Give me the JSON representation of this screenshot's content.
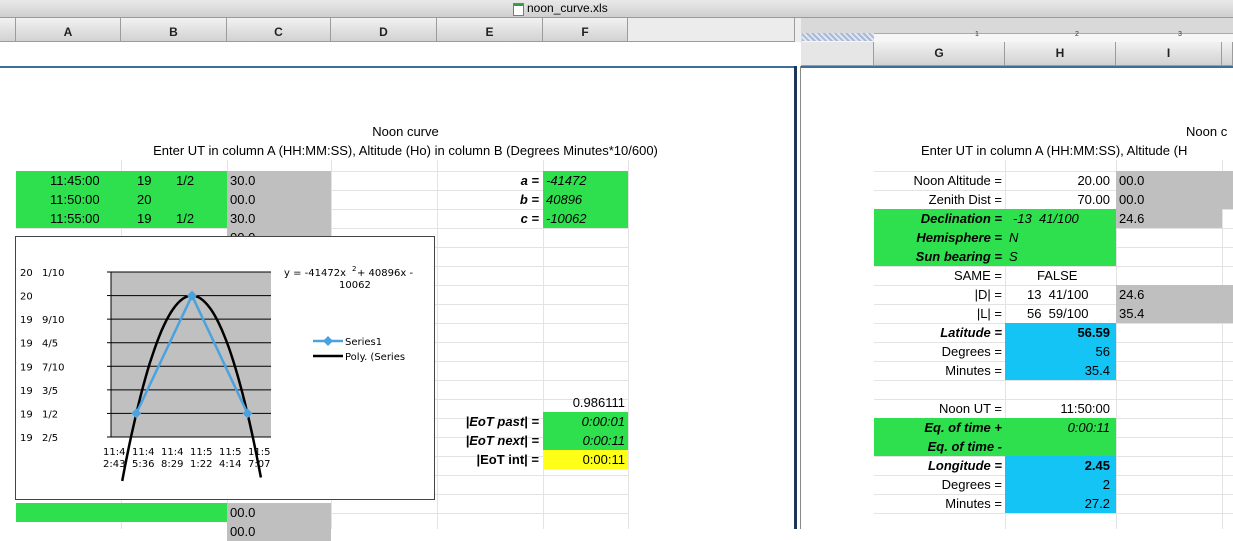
{
  "window": {
    "title": "noon_curve.xls"
  },
  "columns": [
    "A",
    "B",
    "C",
    "D",
    "E",
    "F",
    "G",
    "H",
    "I"
  ],
  "ruler_marks": [
    "1",
    "2",
    "3"
  ],
  "left": {
    "title": "Noon curve",
    "subtitle": "Enter UT in column A (HH:MM:SS), Altitude (Ho) in column B (Degrees Minutes*10/600)",
    "rows": [
      {
        "a": "11:45:00",
        "b": "19",
        "frac": "1/2",
        "c": "30.0"
      },
      {
        "a": "11:50:00",
        "b": "20",
        "frac": "",
        "c": "00.0"
      },
      {
        "a": "11:55:00",
        "b": "19",
        "frac": "1/2",
        "c": "30.0"
      }
    ],
    "partial_c": "00.0",
    "coef": [
      {
        "label": "a =",
        "value": "-41472"
      },
      {
        "label": "b =",
        "value": "40896"
      },
      {
        "label": "c =",
        "value": "-10062"
      }
    ],
    "value_0986": "0.986111",
    "eot": [
      {
        "label": "|EoT past| =",
        "value": "0:00:01"
      },
      {
        "label": "|EoT next| =",
        "value": "0:00:11"
      },
      {
        "label": "|EoT int| =",
        "value": "0:00:11"
      }
    ],
    "bottom_c1": "00.0",
    "bottom_c2": "00.0"
  },
  "chart_data": {
    "type": "line",
    "equation": "y = -41472x² + 40896x - 10062",
    "equation_line1": "y = -41472x",
    "equation_sup": "2",
    "equation_line1b": " + 40896x -",
    "equation_line2": "10062",
    "ytick_labels": [
      {
        "deg": "20",
        "frac": "1/10"
      },
      {
        "deg": "20",
        "frac": ""
      },
      {
        "deg": "19",
        "frac": "9/10"
      },
      {
        "deg": "19",
        "frac": "4/5"
      },
      {
        "deg": "19",
        "frac": "7/10"
      },
      {
        "deg": "19",
        "frac": "3/5"
      },
      {
        "deg": "19",
        "frac": "1/2"
      },
      {
        "deg": "19",
        "frac": "2/5"
      }
    ],
    "ylim": [
      19.4,
      20.1
    ],
    "xtick_top": [
      "11:4",
      "11:4",
      "11:4",
      "11:5",
      "11:5",
      "11:5"
    ],
    "xtick_bot": [
      "2:43",
      "5:36",
      "8:29",
      "1:22",
      "4:14",
      "7:07"
    ],
    "xlim": [
      0.488,
      0.498
    ],
    "series": [
      {
        "name": "Series1",
        "x": [
          0.48958,
          0.49306,
          0.49653
        ],
        "y": [
          19.5,
          20.0,
          19.5
        ],
        "color": "#4aa3df"
      }
    ],
    "trendline": {
      "name": "Poly. (Series",
      "a": -41472,
      "b": 40896,
      "c": -10062,
      "color": "#000000"
    },
    "legend": "right"
  },
  "right": {
    "title": "Noon c",
    "subtitle": "Enter UT in column A (HH:MM:SS), Altitude (H",
    "rows": [
      {
        "label": "Noon Altitude =",
        "h": "20.00",
        "i": "00.0",
        "cls": "",
        "lb": false
      },
      {
        "label": "Zenith Dist =",
        "h": "70.00",
        "i": "00.0",
        "cls": "",
        "lb": false
      },
      {
        "label": "Declination =",
        "h": "-13  41/100",
        "i": "24.6",
        "cls": "g",
        "lb": true
      },
      {
        "label": "Hemisphere =",
        "h": "N",
        "i": "",
        "cls": "g",
        "lb": true
      },
      {
        "label": "Sun bearing =",
        "h": "S",
        "i": "",
        "cls": "g",
        "lb": true
      },
      {
        "label": "SAME =",
        "h": "FALSE",
        "i": "",
        "cls": "",
        "lb": false
      },
      {
        "label": "|D| =",
        "h": "13  41/100",
        "i": "24.6",
        "cls": "",
        "lb": false
      },
      {
        "label": "|L| =",
        "h": "56  59/100",
        "i": "35.4",
        "cls": "",
        "lb": false
      },
      {
        "label": "Latitude =",
        "h": "56.59",
        "i": "",
        "cls": "bl",
        "lb": true
      },
      {
        "label": "Degrees =",
        "h": "56",
        "i": "",
        "cls": "bl",
        "lb": false
      },
      {
        "label": "Minutes =",
        "h": "35.4",
        "i": "",
        "cls": "bl",
        "lb": false
      },
      {
        "label": "",
        "h": "",
        "i": "",
        "cls": "",
        "lb": false
      },
      {
        "label": "Noon UT =",
        "h": "11:50:00",
        "i": "",
        "cls": "",
        "lb": false
      },
      {
        "label": "Eq. of time +",
        "h": "0:00:11",
        "i": "",
        "cls": "g",
        "lb": true
      },
      {
        "label": "Eq. of time -",
        "h": "",
        "i": "",
        "cls": "g",
        "lb": true
      },
      {
        "label": "Longitude =",
        "h": "2.45",
        "i": "",
        "cls": "bl",
        "lb": true
      },
      {
        "label": "Degrees =",
        "h": "2",
        "i": "",
        "cls": "bl",
        "lb": false
      },
      {
        "label": "Minutes =",
        "h": "27.2",
        "i": "",
        "cls": "bl",
        "lb": false
      }
    ]
  }
}
